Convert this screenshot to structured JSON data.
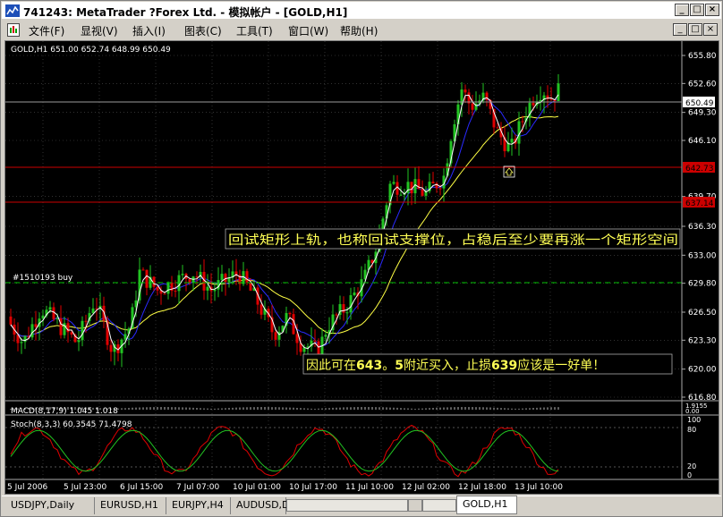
{
  "window": {
    "title": "741243: MetaTrader ?Forex Ltd. - 模拟帐户 - [GOLD,H1]",
    "controls": {
      "minimize": "_",
      "maximize": "□",
      "close": "×"
    }
  },
  "menubar": {
    "items": [
      "文件(F)",
      "显视(V)",
      "插入(I)",
      "图表(C)",
      "工具(T)",
      "窗口(W)",
      "帮助(H)"
    ],
    "controls": {
      "minimize": "_",
      "restore": "□",
      "close": "×"
    }
  },
  "chart": {
    "header": "GOLD,H1  651.00 652.74 648.99 650.49",
    "price_labels": [
      "655.80",
      "652.60",
      "649.30",
      "646.10",
      "639.70",
      "636.30",
      "633.00",
      "629.80",
      "626.50",
      "623.30",
      "620.00",
      "616.80"
    ],
    "current_price": "650.49",
    "line_labels": [
      "642.73",
      "637.14"
    ],
    "order_label": "#1510193 buy",
    "annotation_top": "回试矩形上轨，也称回试支撑位，占稳后至少要再涨一个矩形空间",
    "annotation_bottom_parts": [
      "因此可在",
      "643",
      "。",
      "5",
      "附近买入，止损",
      "639",
      "应该是一好单！"
    ],
    "macd_label": "MACD(8,17,9) 1.045 1.018",
    "macd_scale": [
      "1.9155",
      "0.00"
    ],
    "stoch_label": "Stoch(8,3,3) 60.3545 71.4798",
    "stoch_scale": [
      "100",
      "80",
      "20",
      "0"
    ],
    "time_labels": [
      "5 Jul 2006",
      "5 Jul 23:00",
      "6 Jul 15:00",
      "7 Jul 07:00",
      "10 Jul 01:00",
      "10 Jul 17:00",
      "11 Jul 10:00",
      "12 Jul 02:00",
      "12 Jul 18:00",
      "13 Jul 10:00"
    ],
    "colors": {
      "bull": "#22c322",
      "bear": "#e00000",
      "ma_fast": "#ffffff",
      "ma_mid": "#2a2aff",
      "ma_slow": "#ffff44",
      "level": "#cc0000",
      "order": "#00c000",
      "grid": "#505050"
    }
  },
  "tabs": [
    "USDJPY,Daily",
    "EURUSD,H1",
    "EURJPY,H4",
    "AUDUSD,D",
    "GOLD,H1"
  ],
  "active_tab": "GOLD,H1"
}
